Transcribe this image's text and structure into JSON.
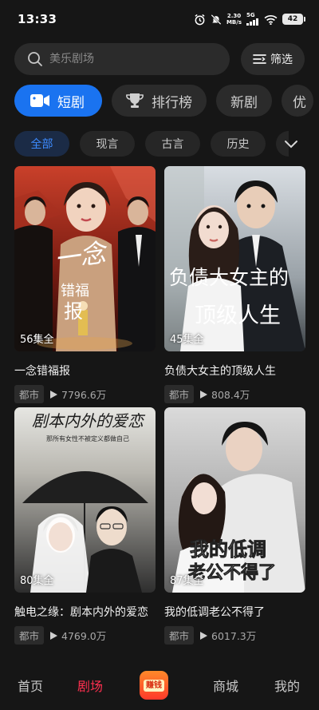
{
  "status_bar": {
    "time": "13:33",
    "net_speed_value": "2.30",
    "net_speed_unit": "MB/s",
    "signal_label": "5G",
    "battery": "42",
    "icons": [
      "alarm-icon",
      "mute-icon",
      "signal-icon",
      "wifi-icon",
      "battery-icon"
    ]
  },
  "search": {
    "placeholder": "美乐剧场",
    "filter_label": "筛选"
  },
  "category_tabs": [
    {
      "label": "短剧",
      "icon": "video-camera-icon",
      "active": true
    },
    {
      "label": "排行榜",
      "icon": "trophy-icon",
      "active": false
    },
    {
      "label": "新剧",
      "active": false
    },
    {
      "label": "优",
      "active": false
    }
  ],
  "sub_tabs": [
    {
      "label": "全部",
      "active": true
    },
    {
      "label": "现言",
      "active": false
    },
    {
      "label": "古言",
      "active": false
    },
    {
      "label": "历史",
      "active": false
    }
  ],
  "dramas": [
    {
      "title": "一念错福报",
      "episodes": "56集全",
      "tag": "都市",
      "plays": "7796.6万",
      "poster_text": "一念错福报"
    },
    {
      "title": "负债大女主的顶级人生",
      "episodes": "45集全",
      "tag": "都市",
      "plays": "808.4万",
      "poster_text": "负债大女主的顶级人生"
    },
    {
      "title": "触电之缘：剧本内外的爱恋",
      "episodes": "80集全",
      "tag": "都市",
      "plays": "4769.0万",
      "poster_text": "剧本内外的爱恋",
      "poster_subtext": "那所有女性不被定义都做自己"
    },
    {
      "title": "我的低调老公不得了",
      "episodes": "87集全",
      "tag": "都市",
      "plays": "6017.3万",
      "poster_text": "我的低调老公不得了"
    }
  ],
  "bottom_nav": {
    "home": "首页",
    "theater": "剧场",
    "earn": "赚钱",
    "mall": "商城",
    "mine": "我的"
  },
  "colors": {
    "background": "#161616",
    "accent_blue": "#1a73f0",
    "active_red": "#ff2f4f"
  }
}
